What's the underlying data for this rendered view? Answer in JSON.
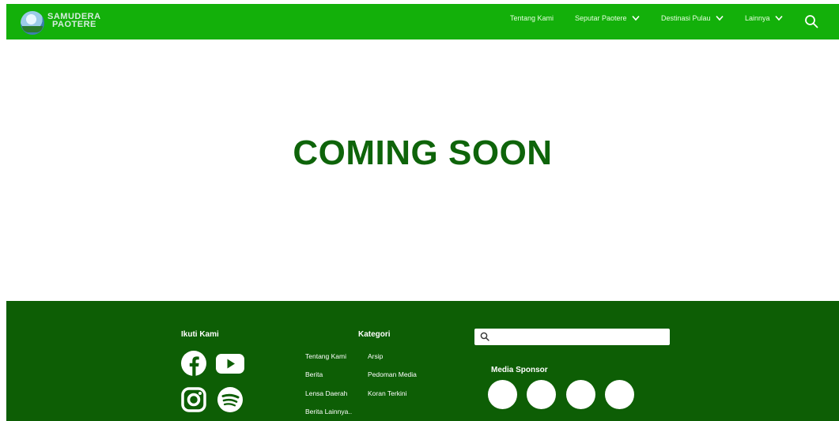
{
  "brand": {
    "logo_line1": "SAMUDERA",
    "logo_line2": "PAOTERE"
  },
  "nav": {
    "items": [
      {
        "label": "Tentang Kami",
        "has_dropdown": false
      },
      {
        "label": "Seputar Paotere",
        "has_dropdown": true
      },
      {
        "label": "Destinasi Pulau",
        "has_dropdown": true
      },
      {
        "label": "Lainnya",
        "has_dropdown": true
      }
    ],
    "search_icon": "search-icon"
  },
  "main": {
    "headline": "COMING SOON"
  },
  "footer": {
    "follow_heading": "Ikuti Kami",
    "social": [
      "facebook-icon",
      "youtube-icon",
      "instagram-icon",
      "spotify-icon"
    ],
    "category_heading": "Kategori",
    "links_col1": [
      "Tentang Kami",
      "Berita",
      "Lensa Daerah",
      "Berita Lainnya.."
    ],
    "links_col2": [
      "Arsip",
      "Pedoman Media",
      "Koran Terkini"
    ],
    "search_placeholder": "",
    "sponsor_heading": "Media Sponsor"
  },
  "colors": {
    "header_bg": "#13b00a",
    "headline": "#0e640a",
    "footer_bg": "#0d5e05"
  }
}
